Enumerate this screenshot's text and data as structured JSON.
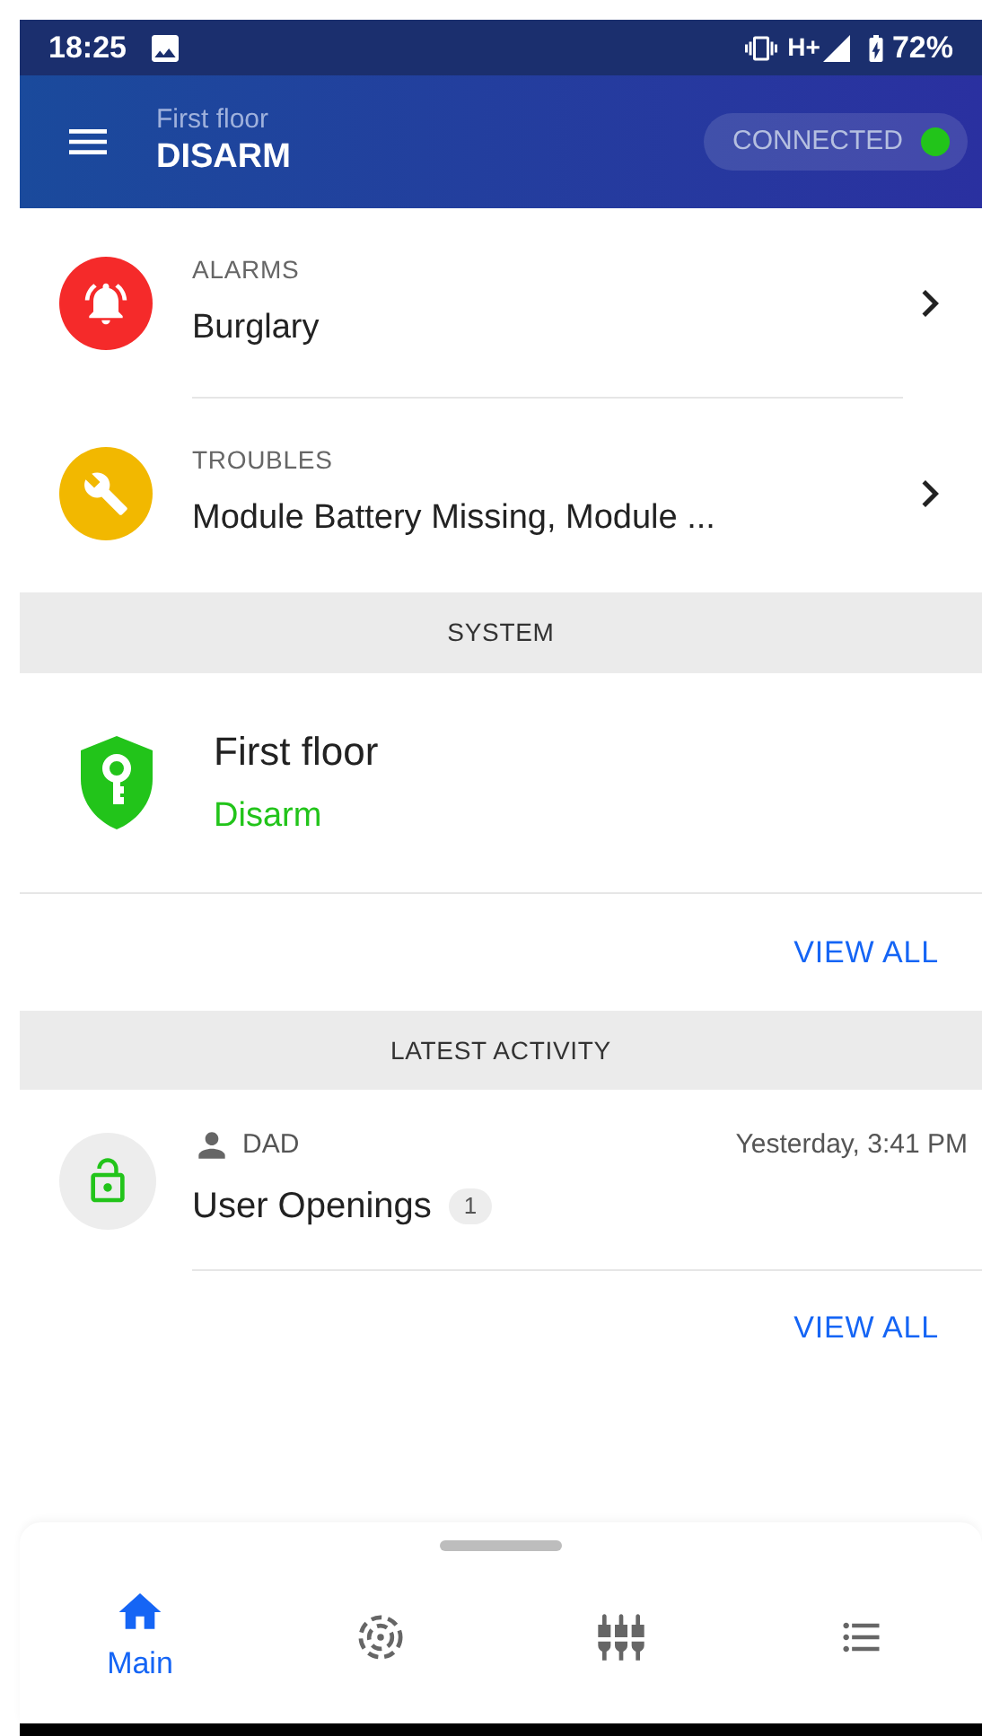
{
  "status_bar": {
    "time": "18:25",
    "network": "H+",
    "battery": "72%"
  },
  "header": {
    "subtitle": "First floor",
    "title": "DISARM",
    "connection": {
      "label": "CONNECTED",
      "color": "#22c41a"
    }
  },
  "notices": [
    {
      "kind": "alarm",
      "label": "ALARMS",
      "text": "Burglary",
      "color": "#f52a2a"
    },
    {
      "kind": "trouble",
      "label": "TROUBLES",
      "text": "Module Battery Missing, Module ...",
      "color": "#f2b800"
    }
  ],
  "system": {
    "heading": "SYSTEM",
    "name": "First floor",
    "state": "Disarm",
    "view_all": "VIEW ALL"
  },
  "latest_activity": {
    "heading": "LATEST ACTIVITY",
    "items": [
      {
        "user": "DAD",
        "time": "Yesterday, 3:41 PM",
        "text": "User Openings",
        "count": "1"
      }
    ],
    "view_all": "VIEW ALL"
  },
  "bottom_nav": [
    {
      "kind": "home",
      "label": "Main",
      "selected": true
    },
    {
      "kind": "sensor",
      "selected": false
    },
    {
      "kind": "controls",
      "selected": false
    },
    {
      "kind": "list",
      "selected": false
    }
  ]
}
